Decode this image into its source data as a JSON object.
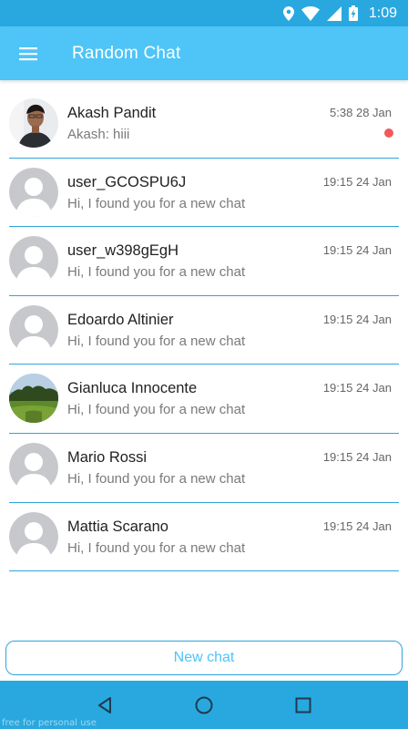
{
  "status_bar": {
    "time": "1:09",
    "icons": [
      "location-icon",
      "wifi-icon",
      "signal-icon",
      "battery-charging-icon"
    ]
  },
  "app_bar": {
    "menu_icon": "hamburger-menu-icon",
    "title": "Random Chat",
    "color": "#4ec4f7"
  },
  "chats": [
    {
      "name": "Akash Pandit",
      "preview": "Akash: hiii",
      "time": "5:38 28 Jan",
      "unread": true,
      "avatar": "photo-person"
    },
    {
      "name": "user_GCOSPU6J",
      "preview": "Hi, I found you for a new chat",
      "time": "19:15 24 Jan",
      "unread": false,
      "avatar": "default-avatar"
    },
    {
      "name": "user_w398gEgH",
      "preview": "Hi, I found you for a new chat",
      "time": "19:15 24 Jan",
      "unread": false,
      "avatar": "default-avatar"
    },
    {
      "name": "Edoardo Altinier",
      "preview": "Hi, I found you for a new chat",
      "time": "19:15 24 Jan",
      "unread": false,
      "avatar": "default-avatar"
    },
    {
      "name": "Gianluca Innocente",
      "preview": "Hi, I found you for a new chat",
      "time": "19:15 24 Jan",
      "unread": false,
      "avatar": "photo-landscape"
    },
    {
      "name": "Mario Rossi",
      "preview": "Hi, I found you for a new chat",
      "time": "19:15 24 Jan",
      "unread": false,
      "avatar": "default-avatar"
    },
    {
      "name": "Mattia Scarano",
      "preview": "Hi, I found you for a new chat",
      "time": "19:15 24 Jan",
      "unread": false,
      "avatar": "default-avatar"
    }
  ],
  "new_chat_button": {
    "label": "New chat"
  },
  "nav_bar": {
    "icons": [
      "back-icon",
      "home-icon",
      "recents-icon"
    ],
    "watermark": "free for personal use"
  },
  "colors": {
    "status_bar": "#29a8e0",
    "accent": "#4ec4f7",
    "divider": "#2fa5dc",
    "unread_dot": "#f05a5a"
  }
}
